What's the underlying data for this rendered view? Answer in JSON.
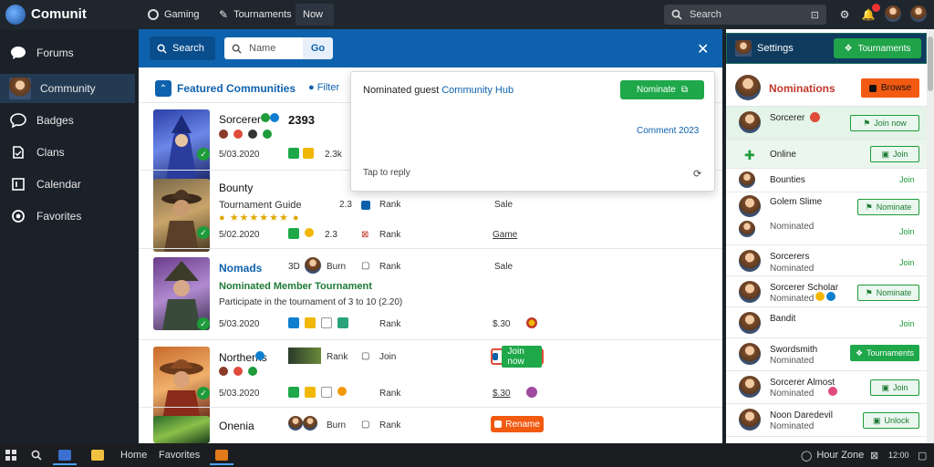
{
  "app": {
    "title": "Comunit"
  },
  "topnav": [
    {
      "label": "Gaming"
    },
    {
      "label": "Tournaments"
    },
    {
      "label": "Now"
    }
  ],
  "search": {
    "placeholder": "Search"
  },
  "sidebar": {
    "items": [
      {
        "label": "Forums",
        "icon": "chat-icon"
      },
      {
        "label": "Community",
        "icon": "avatar-icon"
      },
      {
        "label": "Badges",
        "icon": "badge-icon"
      },
      {
        "label": "Clans",
        "icon": "shield-icon"
      },
      {
        "label": "Calendar",
        "icon": "calendar-icon"
      },
      {
        "label": "Favorites",
        "icon": "star-icon"
      }
    ]
  },
  "main": {
    "search_tab": "Search",
    "search_placeholder": "Name",
    "search_btn": "Go",
    "section_title": "Featured Communities",
    "section_filter": "Filter",
    "games": [
      {
        "name": "Sorcerer",
        "score": "2393",
        "stat": "2.3k",
        "date": "5/03.2020",
        "col3": "",
        "col4": ""
      },
      {
        "name": "Bounty",
        "sub": "Tournament Guide",
        "stat": "2.3",
        "col3": "Rank",
        "col4": "Sale",
        "date": "5/02.2020",
        "col4b": "Game"
      },
      {
        "name": "Nomads",
        "sub": "Nominated Member Tournament",
        "desc": "Participate in the tournament of 3 to 10 (2.20)",
        "stat": "Burn",
        "col3": "Rank",
        "col4": "Sale",
        "date": "5/03.2020",
        "price": "$.30"
      },
      {
        "name": "Northerns",
        "stat": "Rank",
        "col3": "Join",
        "col4": "Join now",
        "date": "5/03.2020",
        "price": "$.30"
      },
      {
        "name": "Onenia",
        "stat": "Burn",
        "col3": "Rank",
        "col4": "Rename",
        "date": ""
      }
    ]
  },
  "popup": {
    "title": "Nominated guest",
    "title_link": "Community Hub",
    "btn": "Nominate",
    "link": "Comment 2023",
    "footer": "Tap to reply",
    "refresh": "⟳"
  },
  "rpanel": {
    "head_name": "Settings",
    "head_btn": "Tournaments",
    "title": "Nominations",
    "title_btn": "Browse",
    "rows": [
      {
        "name": "Sorcerer",
        "btn": "Join now",
        "solid": false
      },
      {
        "name": "Online",
        "btn": "Join",
        "solid": false
      },
      {
        "name": "Bounties",
        "green": "Join"
      },
      {
        "name": "Golem Slime",
        "sub": "Nominated",
        "btn": "Nominate",
        "solid": false,
        "green": "Join"
      },
      {
        "name": "Sorcerers",
        "sub": "Nominated",
        "green": "Join"
      },
      {
        "name": "Sorcerer Scholar",
        "sub": "Nominated",
        "btn": "Nominate",
        "solid": false
      },
      {
        "name": "Bandit",
        "green": "Join"
      },
      {
        "name": "Swordsmith",
        "sub": "Nominated",
        "btn": "Tournaments",
        "solid": true
      },
      {
        "name": "Sorcerer Almost",
        "sub": "Nominated",
        "btn": "Join",
        "solid": false
      },
      {
        "name": "Noon Daredevil",
        "sub": "Nominated",
        "btn": "Unlock",
        "solid": false
      }
    ]
  },
  "taskbar": {
    "items": [
      "Home",
      "Favorites"
    ],
    "tray": "Hour Zone",
    "clock": "12:00"
  },
  "colors": {
    "primary": "#0e62ad",
    "green": "#1ea84a",
    "orange": "#f25a12",
    "dark": "#1b2129"
  }
}
